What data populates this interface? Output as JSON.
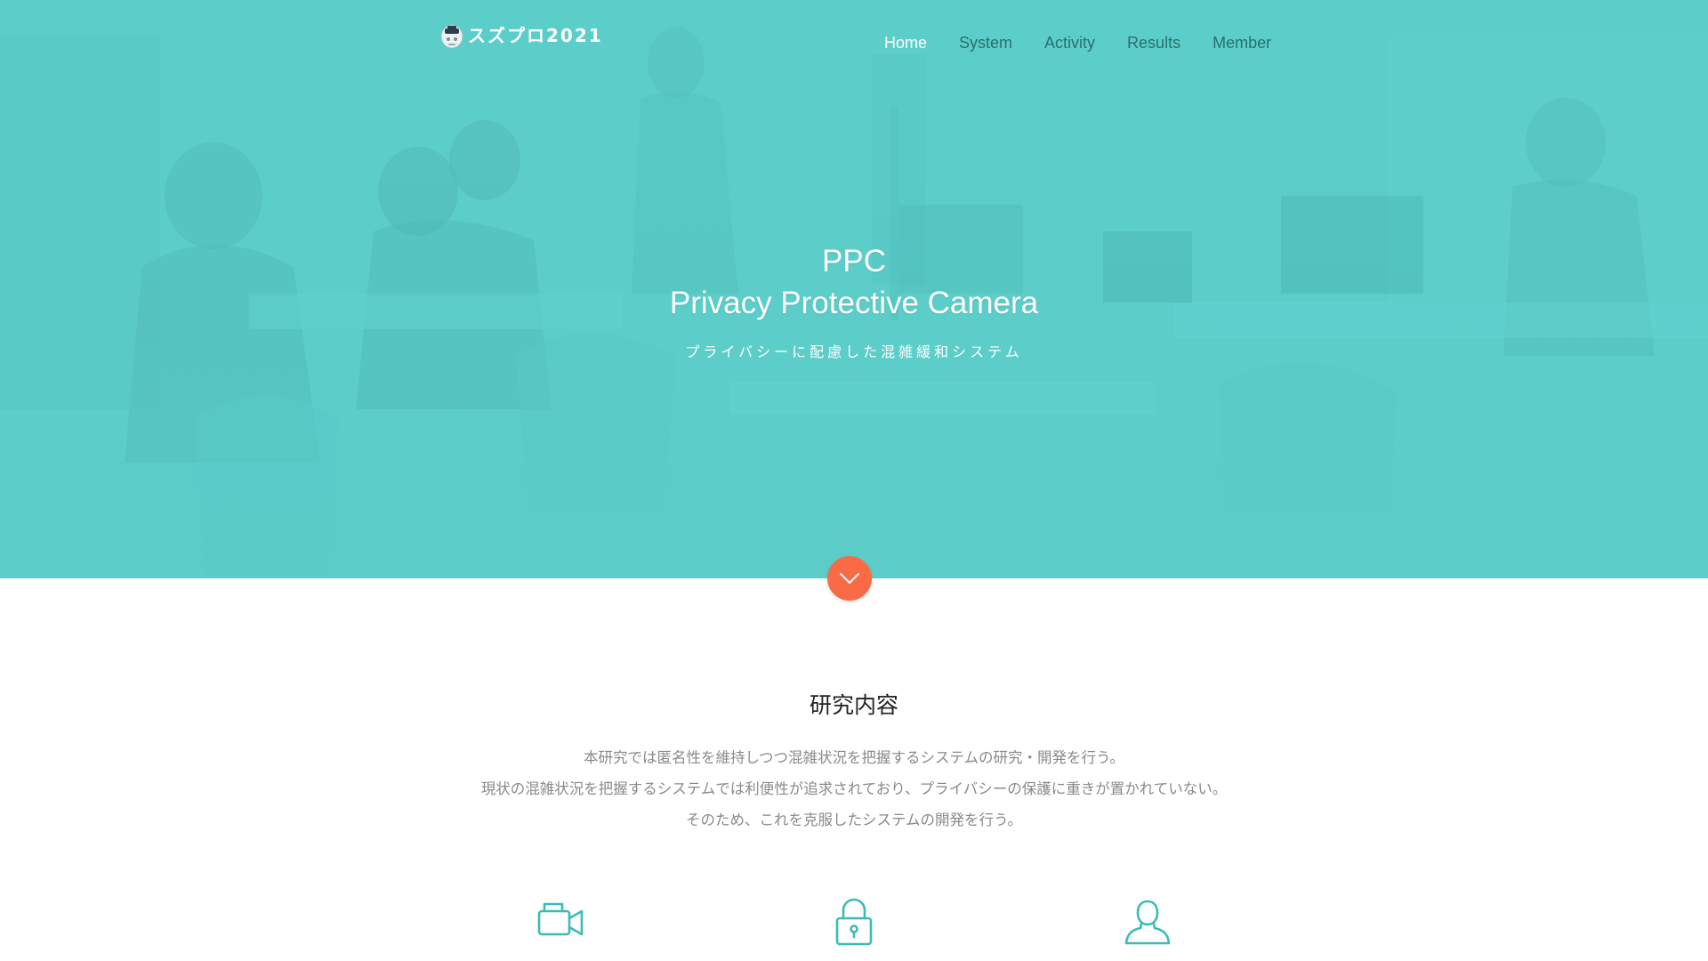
{
  "header": {
    "logo_text": "スズプロ2021",
    "nav": [
      {
        "label": "Home",
        "active": true
      },
      {
        "label": "System",
        "active": false
      },
      {
        "label": "Activity",
        "active": false
      },
      {
        "label": "Results",
        "active": false
      },
      {
        "label": "Member",
        "active": false
      }
    ]
  },
  "hero": {
    "title_line1": "PPC",
    "title_line2": "Privacy Protective Camera",
    "subtitle": "プライバシーに配慮した混雑緩和システム",
    "scroll_icon": "chevron-down-icon"
  },
  "research": {
    "title": "研究内容",
    "description": [
      "本研究では匿名性を維持しつつ混雑状況を把握するシステムの研究・開発を行う。",
      "現状の混雑状況を把握するシステムでは利便性が追求されており、プライバシーの保護に重きが置かれていない。",
      "そのため、これを克服したシステムの開発を行う。"
    ],
    "feature_icons": [
      "video-camera-icon",
      "lock-icon",
      "user-icon"
    ]
  },
  "colors": {
    "hero_teal": "#5ccdc9",
    "accent_orange": "#f96a45",
    "icon_teal": "#3bbcb6",
    "nav_inactive": "#2b6f6c",
    "body_text": "#8a8a8a"
  }
}
